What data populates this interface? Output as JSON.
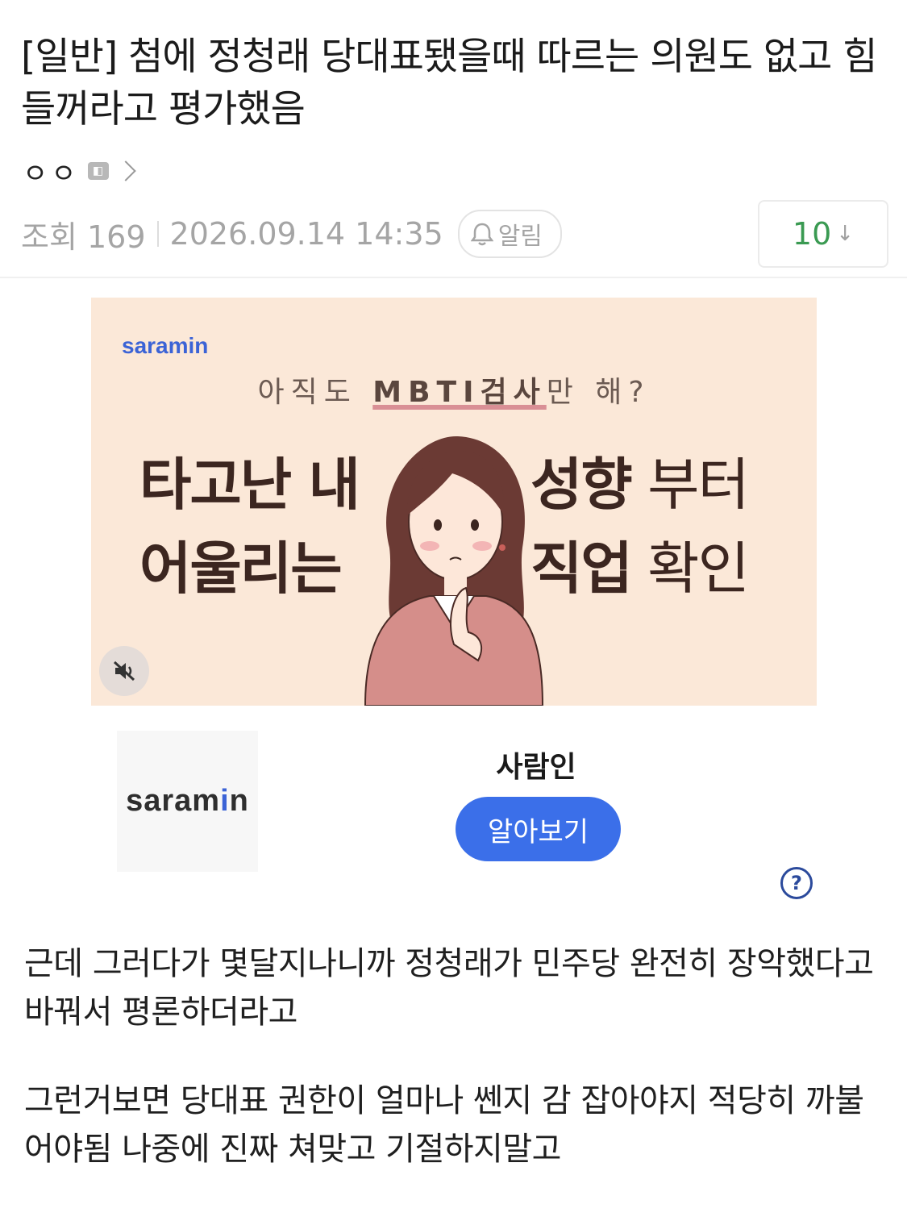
{
  "post": {
    "title": "[일반] 첨에 정청래 당대표됐을때 따르는 의원도 없고 힘들꺼라고 평가했음",
    "author": "ㅇㅇ",
    "views_label": "조회 169",
    "datetime": "2026.09.14 14:35",
    "alarm_label": "알림",
    "comment_count": "10",
    "comment_arrow": "↓"
  },
  "ad": {
    "banner_logo": "saramin",
    "question_prefix": "아직도 ",
    "question_highlight": "MBTI검사",
    "question_suffix": "만 해?",
    "line1_left": "타고난 내",
    "line1_right_bold": "성향",
    "line1_right_light": " 부터",
    "line2_left": "어울리는",
    "line2_right_bold": "직업",
    "line2_right_light": " 확인",
    "advertiser_logo_prefix": "saram",
    "advertiser_logo_i": "i",
    "advertiser_logo_suffix": "n",
    "advertiser_name": "사람인",
    "cta_label": "알아보기",
    "help_symbol": "?",
    "colors": {
      "banner_bg": "#fbe8d8",
      "cta": "#3b6fe9",
      "logo_blue": "#3b63d6"
    }
  },
  "content": {
    "paragraphs": [
      "근데 그러다가 몇달지나니까 정청래가 민주당 완전히 장악했다고 바꿔서 평론하더라고",
      "그런거보면 당대표 권한이 얼마나 쎈지 감 잡아야지 적당히 까불어야됨 나중에 진짜 쳐맞고 기절하지말고"
    ]
  }
}
